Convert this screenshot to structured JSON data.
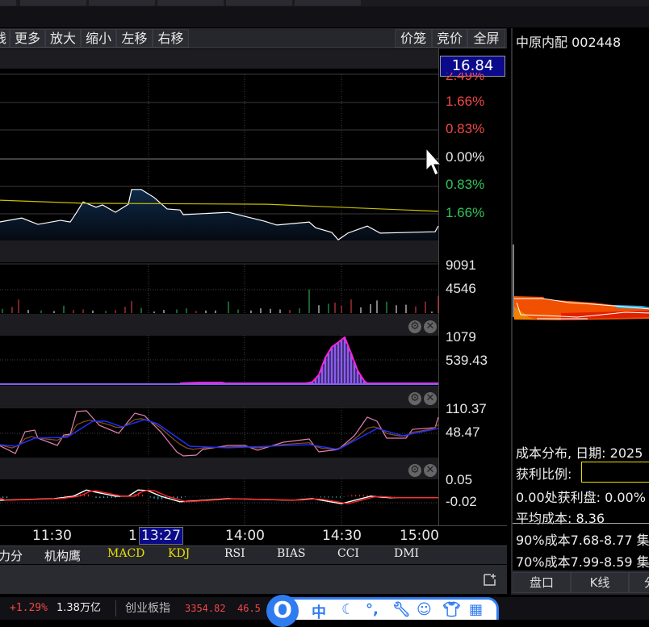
{
  "toolbar": {
    "left": [
      "线",
      "更多",
      "放大",
      "缩小",
      "左移",
      "右移"
    ],
    "right": [
      "价笼",
      "竞价",
      "全屏"
    ]
  },
  "price_box": "16.84",
  "price_axis": {
    "labels": [
      "2.49%",
      "1.66%",
      "0.83%",
      "0.00%",
      "0.83%",
      "1.66%"
    ]
  },
  "volume_axis": [
    "9091",
    "4546"
  ],
  "ind1_axis": [
    "1079",
    "539.43"
  ],
  "ind2_axis": [
    "110.37",
    "48.47"
  ],
  "ind3_axis": [
    "0.05",
    "-0.02"
  ],
  "time_axis": {
    "labels": [
      "11:30",
      "1",
      "14:00",
      "14:30",
      "15:00"
    ],
    "cursor": "13:27"
  },
  "indicator_tabs": [
    "力分",
    "机构鹰",
    "MACD",
    "KDJ",
    "RSI",
    "BIAS",
    "CCI",
    "DMI"
  ],
  "status": {
    "change": "+1.29%",
    "turnover": "1.38万亿",
    "index_name": "创业板指",
    "index_value": "3354.82",
    "index_change": "46.5"
  },
  "right_panel": {
    "title": "中原内配 002448",
    "cost_title": "成本分布, 日期: 2025",
    "profit_ratio_label": "获利比例:",
    "profit_at": "0.00处获利盘: 0.00%",
    "avg_cost": "平均成本: 8.36",
    "cost90": "90%成本7.68-8.77 集",
    "cost70": "70%成本7.99-8.59 集",
    "tabs": [
      "盘口",
      "K线",
      "分"
    ]
  },
  "ime": {
    "logo": "O",
    "lang": "中",
    "icons": [
      "moon-icon",
      "punctuation-icon",
      "wrench-icon",
      "emoji-icon",
      "skin-icon",
      "grid-icon"
    ]
  },
  "colors": {
    "up": "#f04848",
    "down": "#2fc45a",
    "avg": "#c8c000",
    "panel_bg": "#000000"
  },
  "chart_data": {
    "type": "line",
    "x_unit": "trading minute",
    "price_pct": [
      [
        104,
        -1.88
      ],
      [
        111,
        -1.76
      ],
      [
        116,
        -1.95
      ],
      [
        123,
        -1.83
      ],
      [
        126,
        -1.88
      ],
      [
        128,
        -1.59
      ],
      [
        130,
        -1.28
      ],
      [
        134,
        -1.44
      ],
      [
        136,
        -1.37
      ],
      [
        140,
        -1.59
      ],
      [
        144,
        -1.35
      ],
      [
        145,
        -0.91
      ],
      [
        148,
        -0.91
      ],
      [
        152,
        -1.15
      ],
      [
        156,
        -1.49
      ],
      [
        160,
        -1.52
      ],
      [
        161,
        -1.66
      ],
      [
        175,
        -1.59
      ],
      [
        180,
        -1.71
      ],
      [
        186,
        -1.85
      ],
      [
        190,
        -1.97
      ],
      [
        200,
        -1.88
      ],
      [
        202,
        -2.05
      ],
      [
        207,
        -2.19
      ],
      [
        209,
        -2.41
      ],
      [
        212,
        -2.21
      ],
      [
        218,
        -2.0
      ],
      [
        222,
        -2.21
      ],
      [
        239,
        -2.17
      ],
      [
        240,
        -2.0
      ]
    ],
    "avg_pct": [
      [
        104,
        -1.23
      ],
      [
        130,
        -1.32
      ],
      [
        187,
        -1.35
      ],
      [
        240,
        -1.56
      ]
    ],
    "volume": [
      [
        105,
        800,
        "g"
      ],
      [
        108,
        1200,
        "r"
      ],
      [
        110,
        2600,
        "r"
      ],
      [
        113,
        600,
        "w"
      ],
      [
        117,
        500,
        "g"
      ],
      [
        121,
        400,
        "w"
      ],
      [
        124,
        1400,
        "g"
      ],
      [
        127,
        600,
        "r"
      ],
      [
        130,
        700,
        "r"
      ],
      [
        133,
        500,
        "w"
      ],
      [
        137,
        400,
        "g"
      ],
      [
        140,
        600,
        "r"
      ],
      [
        143,
        1200,
        "r"
      ],
      [
        145,
        2300,
        "r"
      ],
      [
        148,
        1000,
        "g"
      ],
      [
        152,
        300,
        "w"
      ],
      [
        155,
        600,
        "w"
      ],
      [
        159,
        700,
        "g"
      ],
      [
        162,
        900,
        "g"
      ],
      [
        165,
        400,
        "r"
      ],
      [
        168,
        500,
        "w"
      ],
      [
        171,
        500,
        "w"
      ],
      [
        175,
        2200,
        "g"
      ],
      [
        178,
        700,
        "g"
      ],
      [
        182,
        500,
        "w"
      ],
      [
        185,
        900,
        "w"
      ],
      [
        188,
        800,
        "w"
      ],
      [
        191,
        700,
        "w"
      ],
      [
        194,
        600,
        "r"
      ],
      [
        197,
        900,
        "g"
      ],
      [
        200,
        4500,
        "g"
      ],
      [
        203,
        1500,
        "w"
      ],
      [
        206,
        1800,
        "g"
      ],
      [
        208,
        2000,
        "r"
      ],
      [
        210,
        1400,
        "r"
      ],
      [
        213,
        2600,
        "r"
      ],
      [
        216,
        1100,
        "w"
      ],
      [
        219,
        1700,
        "w"
      ],
      [
        221,
        2400,
        "w"
      ],
      [
        224,
        2200,
        "g"
      ],
      [
        227,
        1500,
        "w"
      ],
      [
        230,
        1600,
        "w"
      ],
      [
        233,
        1300,
        "r"
      ],
      [
        236,
        2200,
        "r"
      ],
      [
        238,
        300,
        "w"
      ],
      [
        240,
        3300,
        "r"
      ]
    ],
    "ind1": {
      "range": [
        0,
        1079
      ],
      "values": [
        [
          160,
          0
        ],
        [
          166,
          20
        ],
        [
          173,
          20
        ],
        [
          174,
          0
        ],
        [
          199,
          0
        ],
        [
          201,
          30
        ],
        [
          203,
          200
        ],
        [
          205,
          600
        ],
        [
          207,
          850
        ],
        [
          209,
          960
        ],
        [
          211,
          1079
        ],
        [
          213,
          700
        ],
        [
          215,
          300
        ],
        [
          217,
          60
        ],
        [
          218,
          0
        ],
        [
          240,
          0
        ]
      ]
    },
    "ind2": {
      "range": [
        -11.3,
        120
      ],
      "line1": [
        [
          104,
          16.5
        ],
        [
          109,
          -4.9
        ],
        [
          112,
          52.7
        ],
        [
          115,
          57.0
        ],
        [
          116,
          35.7
        ],
        [
          122,
          16.5
        ],
        [
          124,
          44.2
        ],
        [
          126,
          46.3
        ],
        [
          128,
          106.1
        ],
        [
          131,
          108.2
        ],
        [
          135,
          69.8
        ],
        [
          141,
          48.5
        ],
        [
          146,
          101.8
        ],
        [
          149,
          95.4
        ],
        [
          154,
          52.7
        ],
        [
          159,
          -0.6
        ],
        [
          161,
          -11.3
        ],
        [
          165,
          -9.2
        ],
        [
          167,
          5.8
        ],
        [
          175,
          16.5
        ],
        [
          180,
          16.5
        ],
        [
          184,
          3.7
        ],
        [
          192,
          25.0
        ],
        [
          200,
          33.5
        ],
        [
          203,
          -0.6
        ],
        [
          209,
          5.8
        ],
        [
          214,
          42.1
        ],
        [
          218,
          91.2
        ],
        [
          221,
          80.5
        ],
        [
          224,
          35.7
        ],
        [
          230,
          35.7
        ],
        [
          232,
          59.1
        ],
        [
          239,
          63.4
        ],
        [
          240,
          91.2
        ]
      ],
      "line2": [
        [
          104,
          18.6
        ],
        [
          109,
          14.3
        ],
        [
          115,
          35.7
        ],
        [
          125,
          37.8
        ],
        [
          133,
          80.5
        ],
        [
          137,
          80.5
        ],
        [
          142,
          65.5
        ],
        [
          149,
          84.7
        ],
        [
          153,
          74.1
        ],
        [
          163,
          14.3
        ],
        [
          175,
          10.1
        ],
        [
          200,
          18.6
        ],
        [
          209,
          5.8
        ],
        [
          221,
          61.3
        ],
        [
          229,
          42.1
        ],
        [
          240,
          61.3
        ]
      ]
    },
    "ind3": {
      "range": [
        -0.03,
        0.06
      ],
      "line": [
        [
          104,
          -0.012
        ],
        [
          121,
          -0.007
        ],
        [
          127,
          0.001
        ],
        [
          131,
          0.021
        ],
        [
          134,
          0.014
        ],
        [
          140,
          0.001
        ],
        [
          144,
          0.001
        ],
        [
          147,
          0.021
        ],
        [
          150,
          0.019
        ],
        [
          154,
          0.001
        ],
        [
          160,
          -0.017
        ],
        [
          175,
          -0.007
        ],
        [
          195,
          -0.012
        ],
        [
          201,
          -0.007
        ],
        [
          210,
          -0.023
        ],
        [
          219,
          0.001
        ],
        [
          225,
          -0.004
        ],
        [
          240,
          -0.004
        ]
      ]
    }
  }
}
